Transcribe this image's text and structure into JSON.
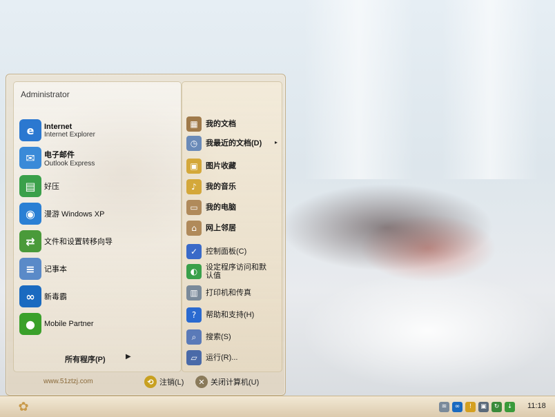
{
  "start_menu": {
    "username": "Administrator",
    "pinned": [
      {
        "name": "internet",
        "main": "Internet",
        "sub": "Internet Explorer",
        "bold": true,
        "icon": "internet-explorer-icon",
        "icon_char": "e",
        "icon_color": "#2b78d0"
      },
      {
        "name": "email",
        "main": "电子邮件",
        "sub": "Outlook Express",
        "bold": true,
        "icon": "outlook-express-icon",
        "icon_char": "✉",
        "icon_color": "#3a8ad8"
      }
    ],
    "recent": [
      {
        "name": "haozip",
        "main": "好压",
        "icon": "haozip-icon",
        "icon_char": "▤",
        "icon_color": "#3aa04a"
      },
      {
        "name": "tour-xp",
        "main": "漫游 Windows XP",
        "icon": "windows-tour-icon",
        "icon_char": "◉",
        "icon_color": "#2a7fd4"
      },
      {
        "name": "transfer-wizard",
        "main": "文件和设置转移向导",
        "icon": "transfer-wizard-icon",
        "icon_char": "⇄",
        "icon_color": "#4a9a3a"
      },
      {
        "name": "notepad",
        "main": "记事本",
        "icon": "notepad-icon",
        "icon_char": "≡",
        "icon_color": "#5a8ac8"
      },
      {
        "name": "antivirus",
        "main": "新毒霸",
        "icon": "duba-antivirus-icon",
        "icon_char": "∞",
        "icon_color": "#1a6ac0"
      },
      {
        "name": "mobile-partner",
        "main": "Mobile Partner",
        "icon": "mobile-partner-icon",
        "icon_char": "●",
        "icon_color": "#3aa02a"
      }
    ],
    "all_programs": "所有程序(P)",
    "right": [
      {
        "name": "my-documents",
        "label": "我的文档",
        "icon": "my-documents-icon",
        "icon_char": "▦",
        "icon_color": "#a07a4a",
        "bold": true
      },
      {
        "name": "recent-documents",
        "label": "我最近的文档(D)",
        "icon": "recent-documents-icon",
        "icon_char": "◷",
        "icon_color": "#6a8ab8",
        "bold": true,
        "arrow": "▸"
      },
      {
        "name": "my-pictures",
        "label": "图片收藏",
        "icon": "my-pictures-icon",
        "icon_char": "▣",
        "icon_color": "#d4a83a",
        "bold": true
      },
      {
        "name": "my-music",
        "label": "我的音乐",
        "icon": "my-music-icon",
        "icon_char": "♪",
        "icon_color": "#d4a83a",
        "bold": true
      },
      {
        "name": "my-computer",
        "label": "我的电脑",
        "icon": "my-computer-icon",
        "icon_char": "▭",
        "icon_color": "#b08a5a",
        "bold": true
      },
      {
        "name": "network-places",
        "label": "网上邻居",
        "icon": "network-places-icon",
        "icon_char": "⌂",
        "icon_color": "#b08a5a",
        "bold": true
      },
      {
        "name": "control-panel",
        "label": "控制面板(C)",
        "icon": "control-panel-icon",
        "icon_char": "✓",
        "icon_color": "#3a6ac8",
        "bold": false
      },
      {
        "name": "default-programs",
        "label": "设定程序访问和默认值",
        "icon": "default-programs-icon",
        "icon_char": "◐",
        "icon_color": "#3aa04a",
        "bold": false
      },
      {
        "name": "printers",
        "label": "打印机和传真",
        "icon": "printer-icon",
        "icon_char": "▥",
        "icon_color": "#7a8a9a",
        "bold": false
      },
      {
        "name": "help",
        "label": "帮助和支持(H)",
        "icon": "help-icon",
        "icon_char": "?",
        "icon_color": "#2a6ad0",
        "bold": false
      },
      {
        "name": "search",
        "label": "搜索(S)",
        "icon": "search-icon",
        "icon_char": "⌕",
        "icon_color": "#5a7ab8",
        "bold": false
      },
      {
        "name": "run",
        "label": "运行(R)...",
        "icon": "run-icon",
        "icon_char": "▱",
        "icon_color": "#4a6aa8",
        "bold": false
      }
    ],
    "website": "www.51ztzj.com",
    "logoff": "注销(L)",
    "shutdown": "关闭计算机(U)"
  },
  "taskbar": {
    "clock": "11:18",
    "tray": [
      {
        "name": "network-tray-icon",
        "char": "≋",
        "color": "#7a8a9a"
      },
      {
        "name": "antivirus-tray-icon",
        "char": "∞",
        "color": "#1a6ac0"
      },
      {
        "name": "shield-tray-icon",
        "char": "!",
        "color": "#d4a020"
      },
      {
        "name": "vm-tray-icon",
        "char": "▣",
        "color": "#5a6a7a"
      },
      {
        "name": "update-tray-icon",
        "char": "↻",
        "color": "#3a8a3a"
      },
      {
        "name": "download-tray-icon",
        "char": "↓",
        "color": "#3a9a3a"
      }
    ]
  }
}
